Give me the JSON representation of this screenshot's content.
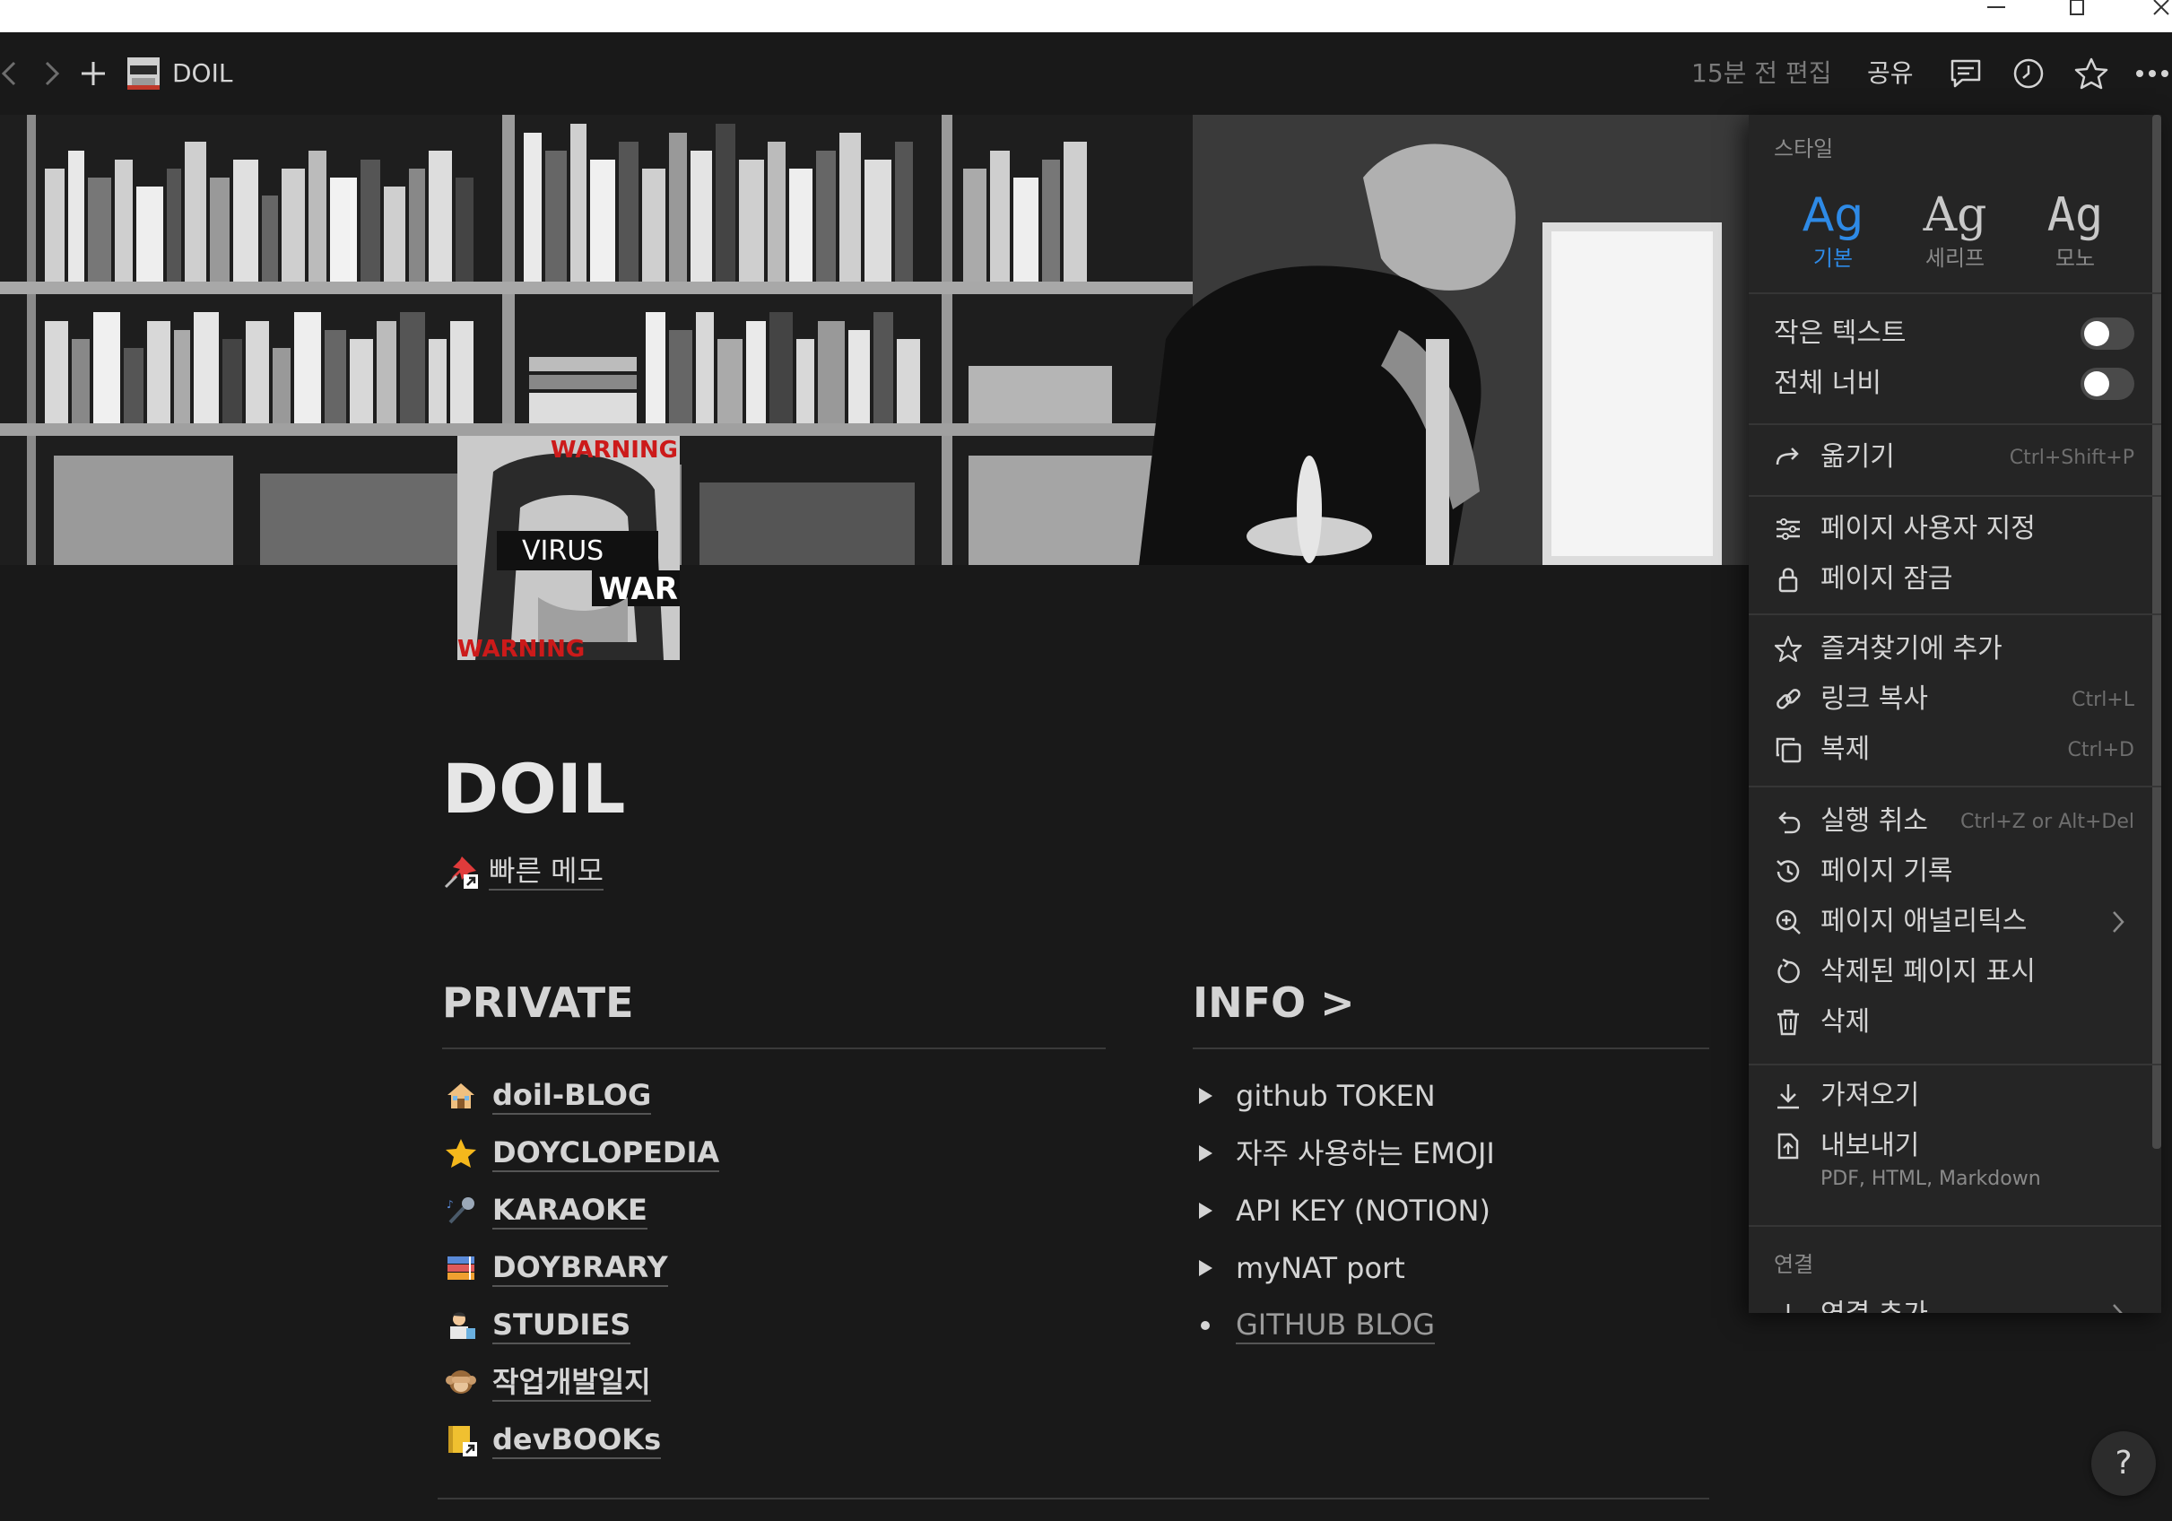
{
  "topbar": {
    "page_title": "DOIL",
    "edited": "15분 전 편집",
    "share": "공유"
  },
  "page": {
    "title": "DOIL",
    "quick_memo": "빠른 메모",
    "icon_text": {
      "top": "WARNING",
      "mid": "VIRUS",
      "war": "WAR",
      "bottom": "WARNING"
    }
  },
  "private": {
    "heading": "PRIVATE",
    "items": [
      {
        "label": "doil-BLOG",
        "icon": "house-icon"
      },
      {
        "label": "DOYCLOPEDIA",
        "icon": "star-icon"
      },
      {
        "label": "KARAOKE",
        "icon": "microphone-icon"
      },
      {
        "label": "DOYBRARY",
        "icon": "books-icon"
      },
      {
        "label": "STUDIES",
        "icon": "scientist-icon"
      },
      {
        "label": "작업개발일지",
        "icon": "monkey-icon"
      },
      {
        "label": "devBOOKs",
        "icon": "notebook-icon"
      }
    ]
  },
  "info": {
    "heading": "INFO >",
    "items": [
      {
        "label": "github TOKEN",
        "type": "toggle"
      },
      {
        "label": "자주 사용하는 EMOJI",
        "type": "toggle"
      },
      {
        "label": "API KEY (NOTION)",
        "type": "toggle"
      },
      {
        "label": "myNAT port",
        "type": "toggle"
      },
      {
        "label": "GITHUB BLOG",
        "type": "bullet-link"
      }
    ]
  },
  "menu": {
    "style_label": "스타일",
    "fonts": [
      {
        "sample": "Ag",
        "name": "기본",
        "selected": true
      },
      {
        "sample": "Ag",
        "name": "세리프",
        "selected": false
      },
      {
        "sample": "Ag",
        "name": "모노",
        "selected": false
      }
    ],
    "small_text": "작은 텍스트",
    "full_width": "전체 너비",
    "move": "옮기기",
    "move_shortcut": "Ctrl+Shift+P",
    "customize": "페이지 사용자 지정",
    "lock": "페이지 잠금",
    "favorite": "즐겨찾기에 추가",
    "copy_link": "링크 복사",
    "copy_link_shortcut": "Ctrl+L",
    "duplicate": "복제",
    "duplicate_shortcut": "Ctrl+D",
    "undo": "실행 취소",
    "undo_shortcut": "Ctrl+Z or Alt+Del",
    "history": "페이지 기록",
    "analytics": "페이지 애널리틱스",
    "show_deleted": "삭제된 페이지 표시",
    "delete": "삭제",
    "import": "가져오기",
    "export": "내보내기",
    "export_formats": "PDF, HTML, Markdown",
    "connections_label": "연결",
    "add_connection": "연결 추가"
  },
  "help": "?",
  "colors": {
    "background": "#191919",
    "menu": "#252525",
    "accent": "#2e8ae6"
  }
}
